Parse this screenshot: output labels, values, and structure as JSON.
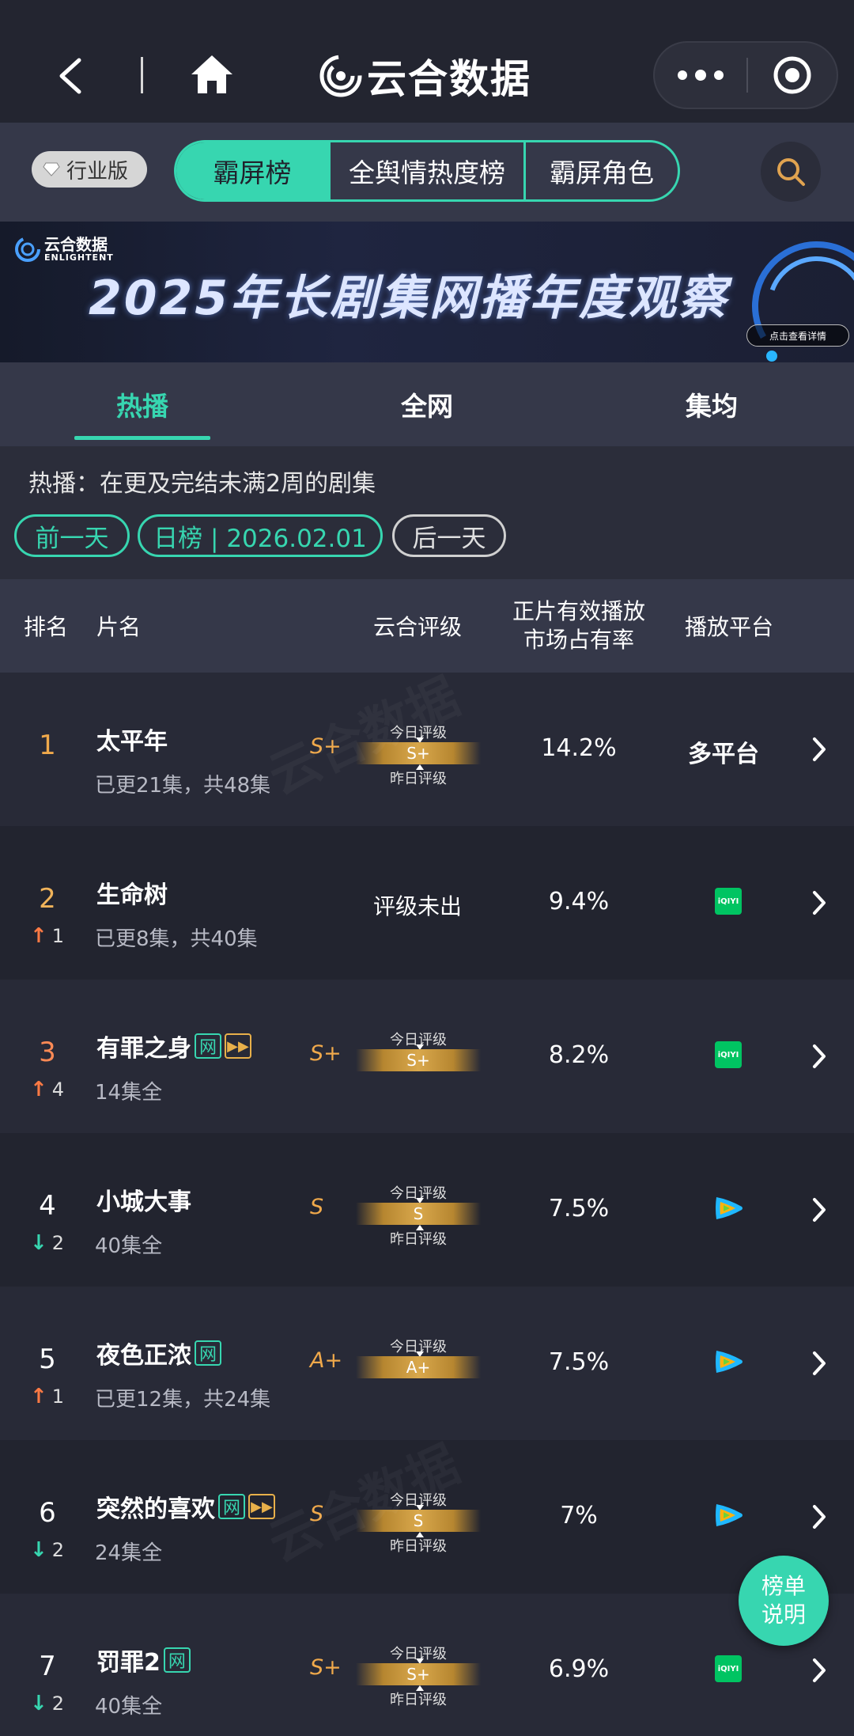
{
  "header": {
    "brand": "云合数据"
  },
  "tabbar": {
    "industry_badge": "行业版",
    "tabs": [
      {
        "label": "霸屏榜",
        "active": true
      },
      {
        "label": "全舆情热度榜",
        "active": false
      },
      {
        "label": "霸屏角色",
        "active": false
      }
    ]
  },
  "banner": {
    "logo_cn": "云合数据",
    "logo_en": "ENLIGHTENT",
    "title": "2025年长剧集网播年度观察",
    "cta": "点击查看详情"
  },
  "subtabs": [
    {
      "label": "热播",
      "active": true
    },
    {
      "label": "全网",
      "active": false
    },
    {
      "label": "集均",
      "active": false
    }
  ],
  "info": {
    "description": "热播：在更及完结未满2周的剧集",
    "prev_day": "前一天",
    "date_label": "日榜 | 2026.02.01",
    "next_day": "后一天"
  },
  "table": {
    "headers": {
      "rank": "排名",
      "name": "片名",
      "grade": "云合评级",
      "share_line1": "正片有效播放",
      "share_line2": "市场占有率",
      "platform": "播放平台"
    },
    "grade_today_label": "今日评级",
    "grade_yesterday_label": "昨日评级",
    "rows": [
      {
        "rank": "1",
        "change_dir": "",
        "change": "",
        "title": "太平年",
        "tags": [],
        "eps": "已更21集，共48集",
        "grade": "S+",
        "grade_bar": "S+",
        "show_today": true,
        "show_yesterday": true,
        "share": "14.2%",
        "platform": "多平台",
        "platform_icon": "text"
      },
      {
        "rank": "2",
        "change_dir": "up",
        "change": "1",
        "title": "生命树",
        "tags": [],
        "eps": "已更8集，共40集",
        "grade": "",
        "grade_none": "评级未出",
        "share": "9.4%",
        "platform": "",
        "platform_icon": "iqiyi"
      },
      {
        "rank": "3",
        "change_dir": "up",
        "change": "4",
        "title": "有罪之身",
        "tags": [
          "net",
          "play"
        ],
        "eps": "14集全",
        "grade": "S+",
        "grade_bar": "S+",
        "show_today": true,
        "show_yesterday": false,
        "share": "8.2%",
        "platform": "",
        "platform_icon": "iqiyi"
      },
      {
        "rank": "4",
        "change_dir": "down",
        "change": "2",
        "title": "小城大事",
        "tags": [],
        "eps": "40集全",
        "grade": "S",
        "grade_bar": "S",
        "show_today": true,
        "show_yesterday": true,
        "share": "7.5%",
        "platform": "",
        "platform_icon": "tencent"
      },
      {
        "rank": "5",
        "change_dir": "up",
        "change": "1",
        "title": "夜色正浓",
        "tags": [
          "net"
        ],
        "eps": "已更12集，共24集",
        "grade": "A+",
        "grade_bar": "A+",
        "show_today": true,
        "show_yesterday": false,
        "share": "7.5%",
        "platform": "",
        "platform_icon": "tencent"
      },
      {
        "rank": "6",
        "change_dir": "down",
        "change": "2",
        "title": "突然的喜欢",
        "tags": [
          "net",
          "play"
        ],
        "eps": "24集全",
        "grade": "S",
        "grade_bar": "S",
        "show_today": true,
        "show_yesterday": true,
        "share": "7%",
        "platform": "",
        "platform_icon": "tencent"
      },
      {
        "rank": "7",
        "change_dir": "down",
        "change": "2",
        "title": "罚罪2",
        "tags": [
          "net"
        ],
        "eps": "40集全",
        "grade": "S+",
        "grade_bar": "S+",
        "show_today": true,
        "show_yesterday": true,
        "share": "6.9%",
        "platform": "",
        "platform_icon": "iqiyi"
      }
    ],
    "tag_net": "网",
    "iqiyi_text": "iQIYI"
  },
  "float_button": {
    "line1": "榜单",
    "line2": "说明"
  },
  "watermark": "云合数据",
  "colors": {
    "accent": "#37d6b0",
    "grade": "#f0a94b",
    "up": "#ff7a44",
    "down": "#37d6b0"
  }
}
